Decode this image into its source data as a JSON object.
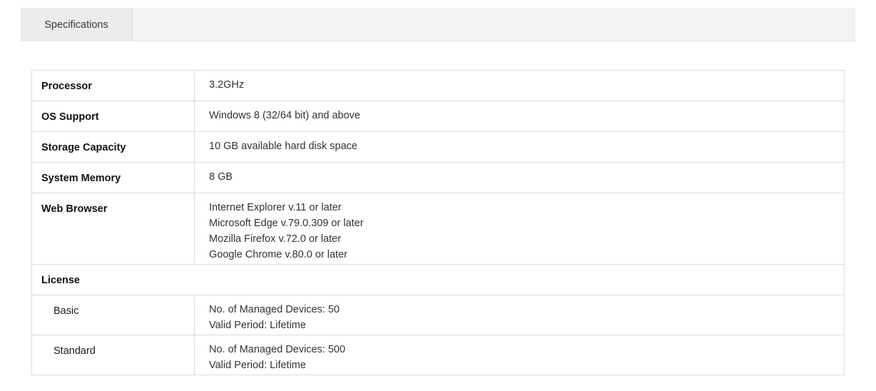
{
  "tabs": [
    {
      "label": "Specifications",
      "active": true
    }
  ],
  "specs": {
    "processor": {
      "label": "Processor",
      "value": "3.2GHz"
    },
    "os": {
      "label": "OS Support",
      "value": "Windows 8 (32/64 bit) and above"
    },
    "storage": {
      "label": "Storage Capacity",
      "value": "10 GB available hard disk space"
    },
    "memory": {
      "label": "System Memory",
      "value": "8 GB"
    },
    "browser": {
      "label": "Web Browser",
      "values": [
        "Internet Explorer v.11 or later",
        "Microsoft Edge v.79.0.309 or later",
        "Mozilla Firefox v.72.0 or later",
        "Google Chrome v.80.0 or later"
      ]
    },
    "license": {
      "label": "License",
      "plans": [
        {
          "name": "Basic",
          "lines": [
            "No. of Managed Devices: 50",
            "Valid Period: Lifetime"
          ]
        },
        {
          "name": "Standard",
          "lines": [
            "No. of Managed Devices: 500",
            "Valid Period: Lifetime"
          ]
        }
      ]
    }
  },
  "colors": {
    "tabbar_bg": "#f2f2f3",
    "tab_bg": "#ececee",
    "border": "#dcdcdc"
  }
}
